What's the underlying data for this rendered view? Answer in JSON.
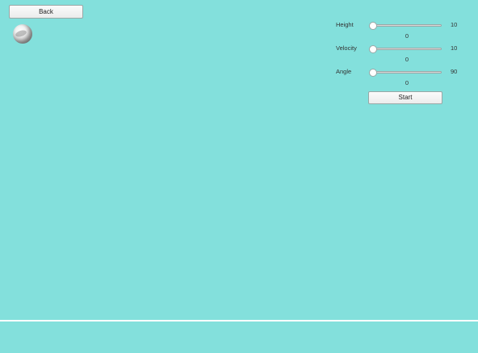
{
  "nav": {
    "back_label": "Back"
  },
  "controls": {
    "height": {
      "label": "Height",
      "value": "10",
      "reading": "0"
    },
    "velocity": {
      "label": "Velocity",
      "value": "10",
      "reading": "0"
    },
    "angle": {
      "label": "Angle",
      "value": "90",
      "reading": "0"
    },
    "start_label": "Start"
  },
  "colors": {
    "background": "#83e0dc",
    "ground": "#ffffff"
  },
  "icons": {
    "projectile": "ball-icon"
  }
}
